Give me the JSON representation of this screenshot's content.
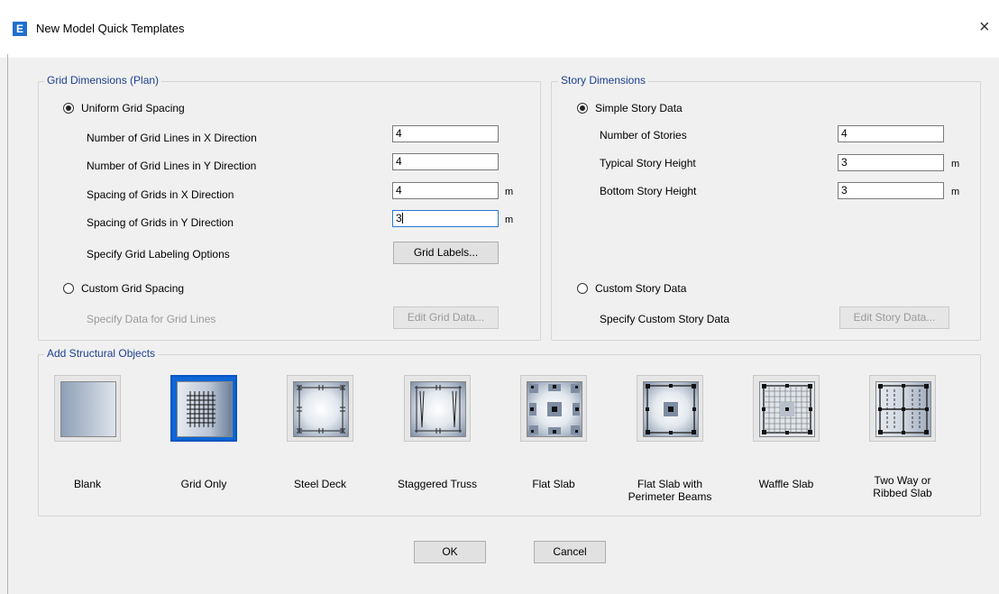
{
  "window": {
    "title": "New Model Quick Templates",
    "app_icon_letter": "E",
    "close_glyph": "×"
  },
  "grid_dimensions": {
    "legend": "Grid Dimensions (Plan)",
    "uniform_label": "Uniform Grid Spacing",
    "uniform_selected": true,
    "fields": [
      {
        "label": "Number of Grid Lines in X Direction",
        "value": "4",
        "unit": ""
      },
      {
        "label": "Number of Grid Lines in Y Direction",
        "value": "4",
        "unit": ""
      },
      {
        "label": "Spacing of Grids in X Direction",
        "value": "4",
        "unit": "m"
      },
      {
        "label": "Spacing of Grids in Y Direction",
        "value": "3",
        "unit": "m"
      }
    ],
    "labeling_label": "Specify Grid Labeling Options",
    "grid_labels_button": "Grid Labels...",
    "custom_label": "Custom Grid Spacing",
    "custom_selected": false,
    "custom_data_label": "Specify Data for Grid Lines",
    "edit_grid_button": "Edit Grid Data..."
  },
  "story_dimensions": {
    "legend": "Story Dimensions",
    "simple_label": "Simple Story Data",
    "simple_selected": true,
    "fields": [
      {
        "label": "Number of Stories",
        "value": "4",
        "unit": ""
      },
      {
        "label": "Typical Story Height",
        "value": "3",
        "unit": "m"
      },
      {
        "label": "Bottom Story Height",
        "value": "3",
        "unit": "m"
      }
    ],
    "custom_label": "Custom Story Data",
    "custom_selected": false,
    "custom_data_label": "Specify Custom Story Data",
    "edit_story_button": "Edit Story Data..."
  },
  "structural_objects": {
    "legend": "Add Structural Objects",
    "selected": "grid-only",
    "items": [
      {
        "id": "blank",
        "label": "Blank"
      },
      {
        "id": "grid-only",
        "label": "Grid Only"
      },
      {
        "id": "steel-deck",
        "label": "Steel Deck"
      },
      {
        "id": "staggered-truss",
        "label": "Staggered Truss"
      },
      {
        "id": "flat-slab",
        "label": "Flat Slab"
      },
      {
        "id": "flat-slab-perimeter",
        "label": "Flat Slab with\nPerimeter Beams"
      },
      {
        "id": "waffle-slab",
        "label": "Waffle Slab"
      },
      {
        "id": "two-way-ribbed",
        "label": "Two Way or\nRibbed Slab"
      }
    ]
  },
  "footer": {
    "ok_label": "OK",
    "cancel_label": "Cancel"
  },
  "colors": {
    "accent": "#0f66d6",
    "legend_text": "#1e3f8f",
    "disabled_text": "#9a9a9a"
  }
}
